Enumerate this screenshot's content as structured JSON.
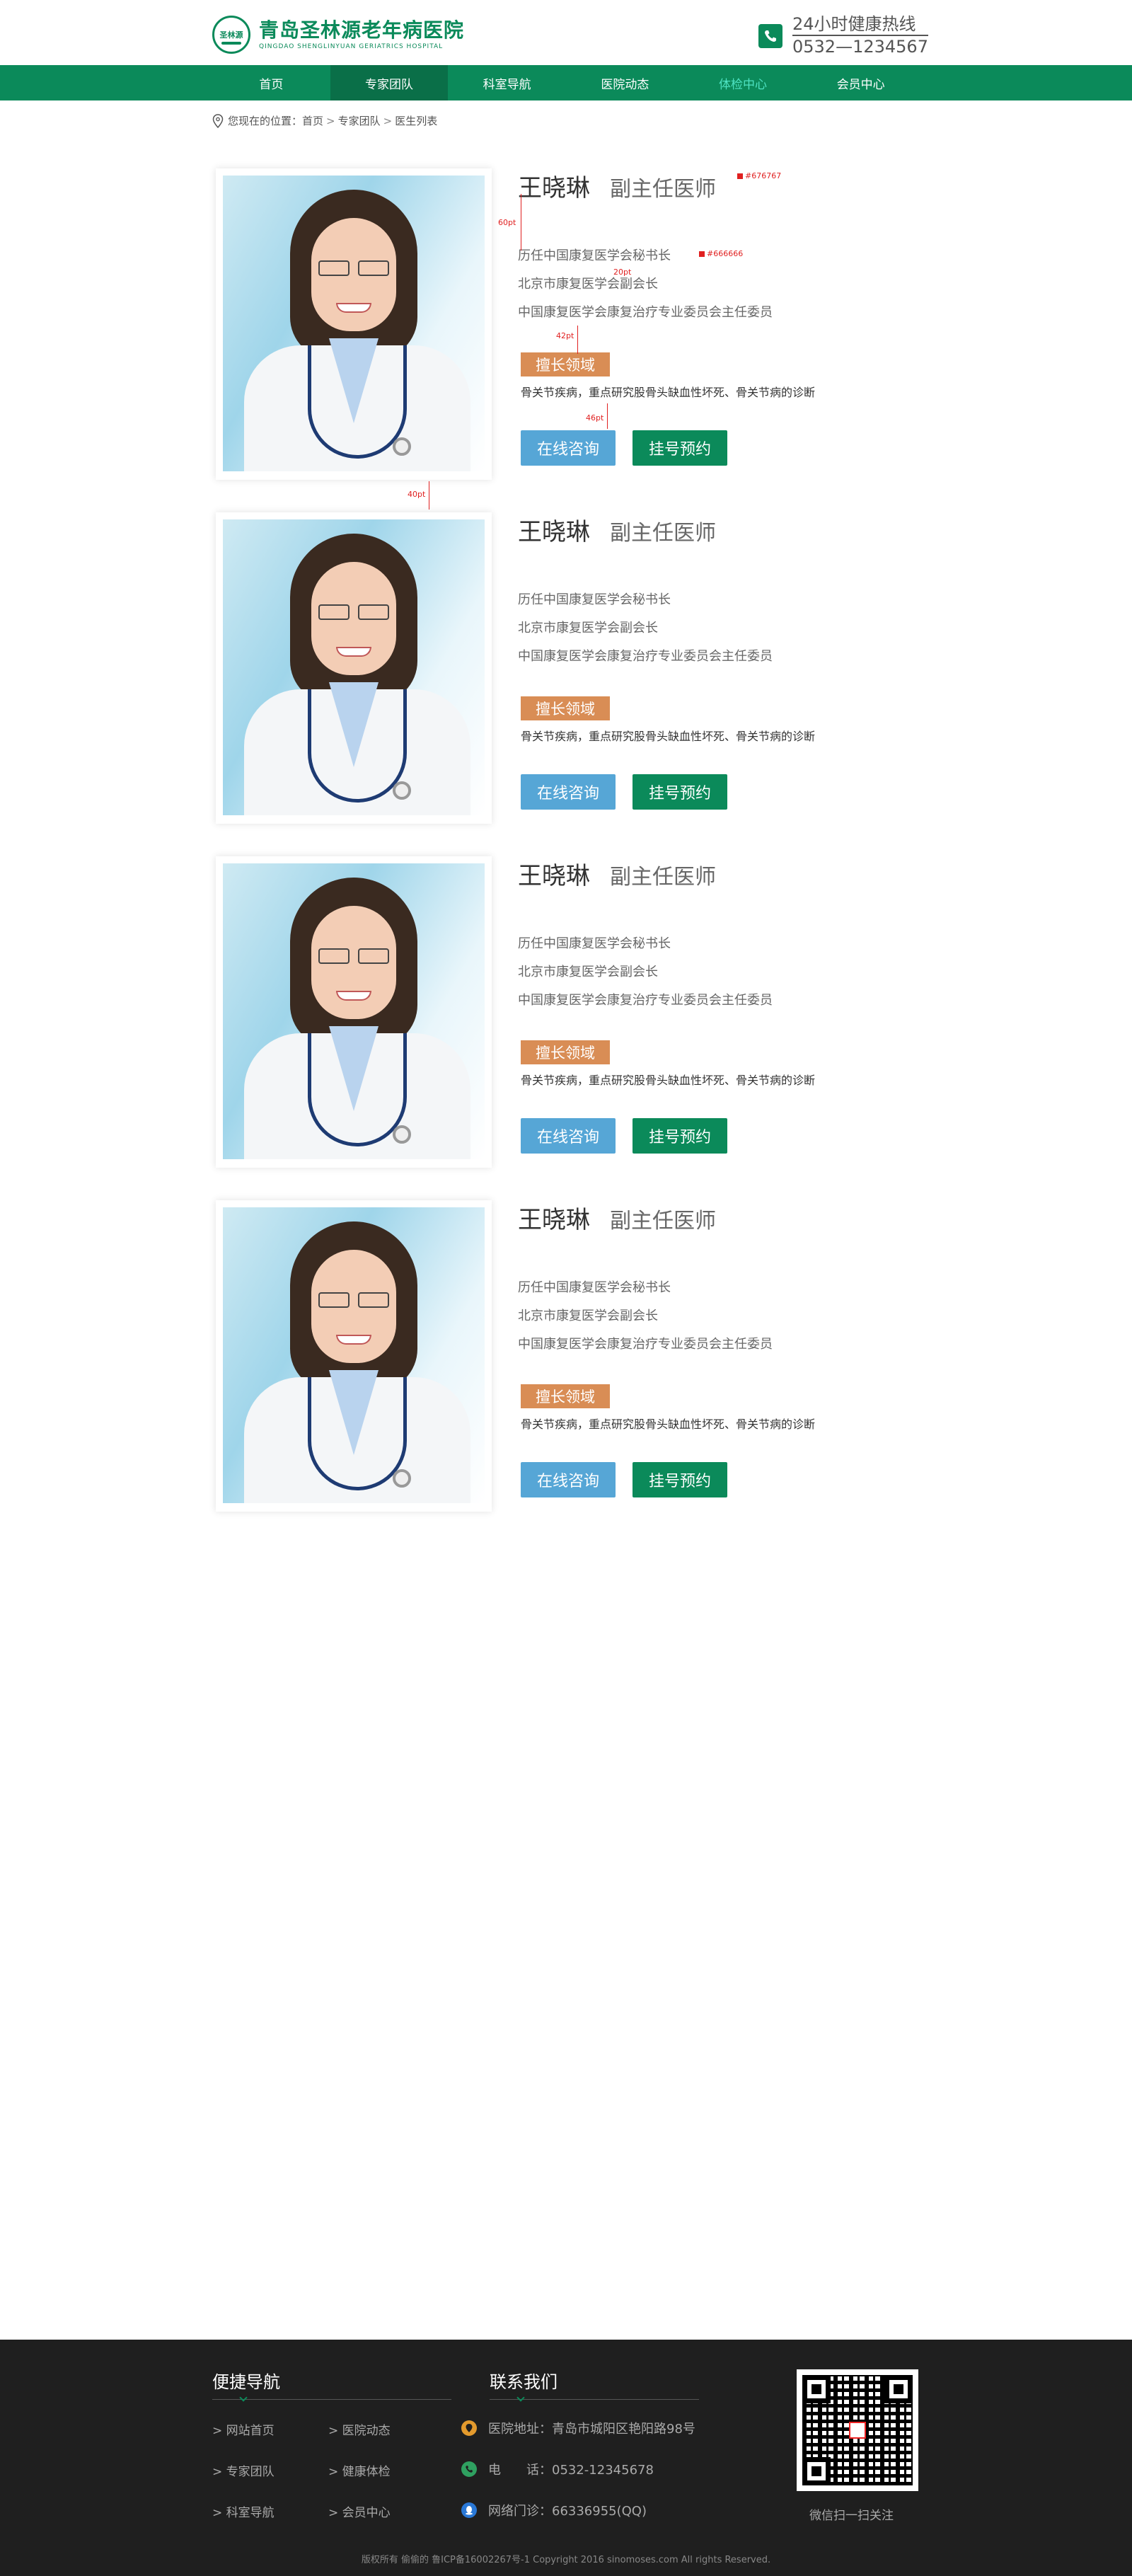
{
  "header": {
    "logo_title": "青岛圣林源老年病医院",
    "logo_sub": "QINGDAO SHENGLINYUAN GERIATRICS HOSPITAL",
    "logo_emblem": "圣林源",
    "hotline_label": "24小时健康热线",
    "hotline_number": "0532—1234567"
  },
  "nav": {
    "items": [
      {
        "label": "首页"
      },
      {
        "label": "专家团队"
      },
      {
        "label": "科室导航"
      },
      {
        "label": "医院动态"
      },
      {
        "label": "体检中心"
      },
      {
        "label": "会员中心"
      }
    ]
  },
  "breadcrumb": {
    "prefix": "您现在的位置：",
    "items": [
      "首页",
      "专家团队",
      "医生列表"
    ],
    "sep": ">"
  },
  "doctors": [
    {
      "name": "王晓琳",
      "title": "副主任医师",
      "lines": [
        "历任中国康复医学会秘书长",
        "北京市康复医学会副会长",
        "中国康复医学会康复治疗专业委员会主任委员"
      ],
      "specialty_label": "擅长领域",
      "specialty": "骨关节疾病，重点研究股骨头缺血性坏死、骨关节病的诊断",
      "consult_label": "在线咨询",
      "book_label": "挂号预约"
    },
    {
      "name": "王晓琳",
      "title": "副主任医师",
      "lines": [
        "历任中国康复医学会秘书长",
        "北京市康复医学会副会长",
        "中国康复医学会康复治疗专业委员会主任委员"
      ],
      "specialty_label": "擅长领域",
      "specialty": "骨关节疾病，重点研究股骨头缺血性坏死、骨关节病的诊断",
      "consult_label": "在线咨询",
      "book_label": "挂号预约"
    },
    {
      "name": "王晓琳",
      "title": "副主任医师",
      "lines": [
        "历任中国康复医学会秘书长",
        "北京市康复医学会副会长",
        "中国康复医学会康复治疗专业委员会主任委员"
      ],
      "specialty_label": "擅长领域",
      "specialty": "骨关节疾病，重点研究股骨头缺血性坏死、骨关节病的诊断",
      "consult_label": "在线咨询",
      "book_label": "挂号预约"
    },
    {
      "name": "王晓琳",
      "title": "副主任医师",
      "lines": [
        "历任中国康复医学会秘书长",
        "北京市康复医学会副会长",
        "中国康复医学会康复治疗专业委员会主任委员"
      ],
      "specialty_label": "擅长领域",
      "specialty": "骨关节疾病，重点研究股骨头缺血性坏死、骨关节病的诊断",
      "consult_label": "在线咨询",
      "book_label": "挂号预约"
    }
  ],
  "annotations": {
    "color_title": "#676767",
    "color_text": "#666666",
    "gap_60": "60pt",
    "gap_20": "20pt",
    "gap_42": "42pt",
    "gap_46": "46pt",
    "gap_40": "40pt"
  },
  "footer": {
    "nav_title": "便捷导航",
    "contact_title": "联系我们",
    "links_col1": [
      "> 网站首页",
      "> 专家团队",
      "> 科室导航"
    ],
    "links_col2": [
      "> 医院动态",
      "> 健康体检",
      "> 会员中心"
    ],
    "contact": [
      {
        "label": "医院地址：青岛市城阳区艳阳路98号",
        "icon": "location-icon",
        "color": "#e39a2d"
      },
      {
        "label": "电　　话：0532-12345678",
        "icon": "phone-icon",
        "color": "#2fa060"
      },
      {
        "label": "网络门诊：66336955(QQ)",
        "icon": "qq-icon",
        "color": "#2a78d6"
      }
    ],
    "qr_label": "微信扫一扫关注",
    "copyright": "版权所有 偷偷的 鲁ICP备16002267号-1 Copyright 2016 sinomoses.com All rights Reserved."
  },
  "colors": {
    "brand_green": "#0b8a5a",
    "nav_active": "#0a6f48",
    "consult_blue": "#56a6d6",
    "tag_orange": "#d98d55",
    "footer_bg": "#1f1f1f"
  }
}
